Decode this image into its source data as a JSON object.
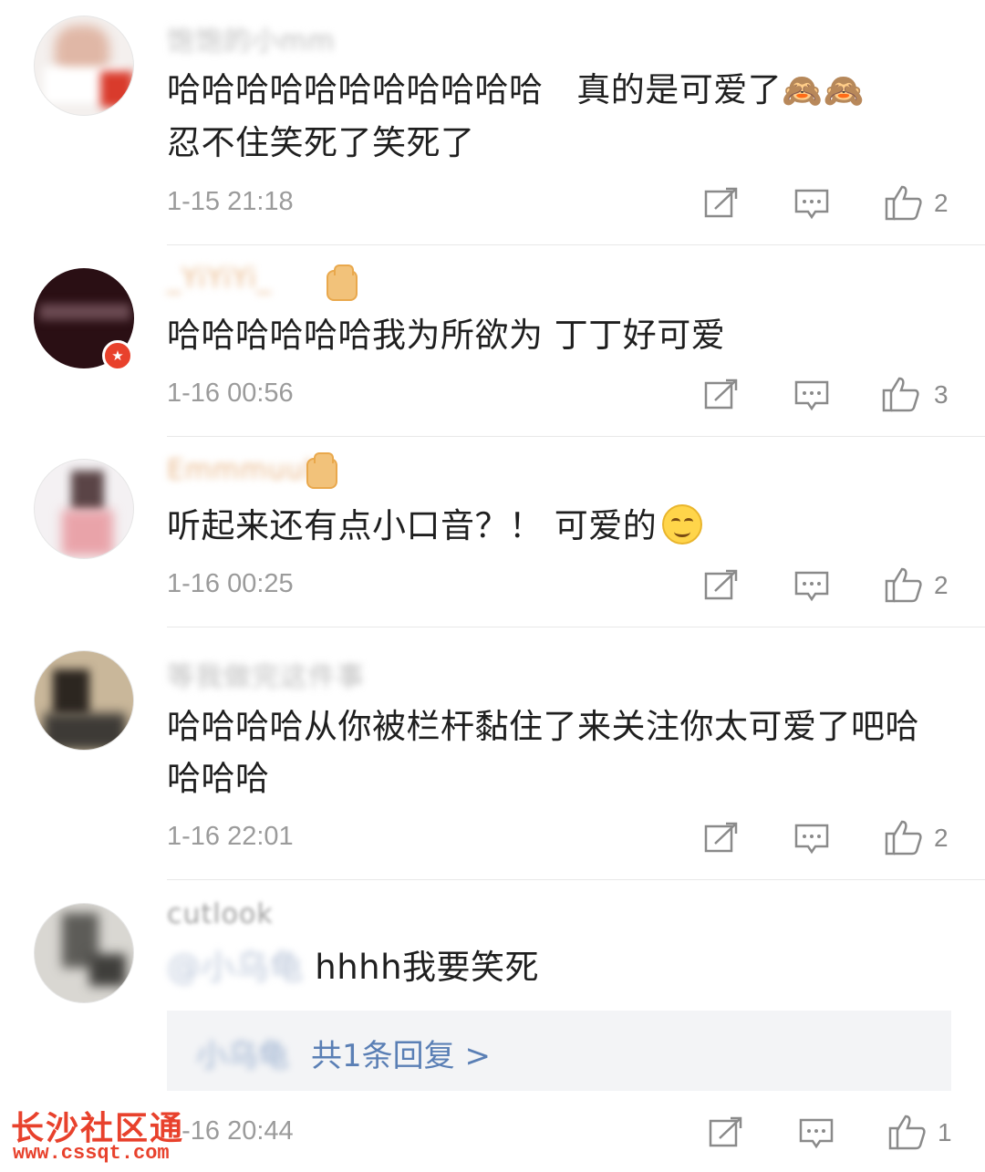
{
  "colors": {
    "text": "#1f1f1f",
    "meta": "#9b9b9b",
    "link": "#5a7fb5",
    "watermark": "#e8412c"
  },
  "comments": [
    {
      "username": "饱饱的小mm",
      "text_line1": "哈哈哈哈哈哈哈哈哈哈哈   真的是可爱了",
      "emoji": "🙈🙈",
      "text_line2": "忍不住笑死了笑死了",
      "time": "1-15 21:18",
      "likes": "2"
    },
    {
      "username": "_YiYiYi_",
      "text": "哈哈哈哈哈哈我为所欲为 丁丁好可爱",
      "time": "1-16 00:56",
      "likes": "3"
    },
    {
      "username": "Emmmuuh",
      "text": "听起来还有点小口音？！ 可爱的",
      "time": "1-16 00:25",
      "likes": "2"
    },
    {
      "username": "等我做完这件事",
      "text_line1": "哈哈哈哈从你被栏杆黏住了来关注你太可爱了吧哈",
      "text_line2": "哈哈哈",
      "time": "1-16 22:01",
      "likes": "2"
    },
    {
      "username": "cutlook",
      "mention": "@小乌龟",
      "text": " hhhh我要笑死",
      "reply_user": "小乌龟",
      "reply_link": "共1条回复 >",
      "time": "1-16 20:44",
      "likes": "1"
    }
  ],
  "watermark": {
    "title": "长沙社区通",
    "url": "www.cssqt.com"
  },
  "icons": {
    "share": "share-icon",
    "comment": "comment-icon",
    "like": "thumbs-up-icon"
  }
}
